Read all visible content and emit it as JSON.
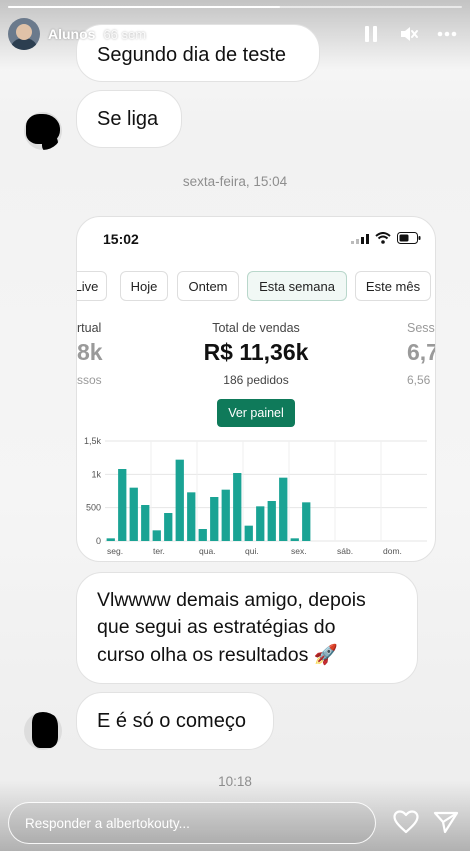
{
  "story": {
    "username": "Alunos",
    "time_ago": "66 sem",
    "progress": 0.6
  },
  "messages": {
    "m1": "Segundo dia de teste",
    "m2": "Se liga",
    "timestamp1": "sexta-feira, 15:04",
    "m3_line1": "Vlwwww demais amigo, depois",
    "m3_line2": "que segui as estratégias do",
    "m3_line3": "curso olha os resultados",
    "m3_emoji": "🚀",
    "m4": "E é só o começo",
    "timestamp2": "10:18"
  },
  "screenshot": {
    "clock": "15:02",
    "tabs": [
      "Live",
      "Hoje",
      "Ontem",
      "Esta semana",
      "Este mês"
    ],
    "active_tab": "Esta semana",
    "left_metric": {
      "label": "rtual",
      "value": "8k",
      "sub": "ssos"
    },
    "center_metric": {
      "label": "Total de vendas",
      "value": "R$ 11,36k",
      "sub": "186 pedidos"
    },
    "right_metric": {
      "label": "Sess",
      "value": "6,7",
      "sub": "6,56"
    },
    "button_label": "Ver painel",
    "chart_data": {
      "type": "bar",
      "categories": [
        "seg.",
        "",
        "",
        "",
        "ter.",
        "",
        "",
        "",
        "qua.",
        "",
        "",
        "",
        "qui.",
        "",
        "",
        "",
        "sex.",
        "",
        "",
        "",
        "sáb.",
        "",
        "",
        "",
        "dom.",
        "",
        "",
        ""
      ],
      "x_tick_labels": [
        "seg.",
        "ter.",
        "qua.",
        "qui.",
        "sex.",
        "sáb.",
        "dom."
      ],
      "values": [
        40,
        1080,
        800,
        540,
        160,
        420,
        1220,
        730,
        180,
        660,
        770,
        1020,
        230,
        520,
        600,
        950,
        40,
        580,
        0,
        0,
        0,
        0,
        0,
        0,
        0,
        0,
        0,
        0
      ],
      "yticks": [
        "0",
        "500",
        "1k",
        "1,5k"
      ],
      "ylim": [
        0,
        1500
      ],
      "color": "#1aa394",
      "grid": true
    }
  },
  "reply": {
    "placeholder": "Responder a albertokouty..."
  },
  "colors": {
    "accent": "#0f7a5a",
    "bar": "#1aa394"
  }
}
